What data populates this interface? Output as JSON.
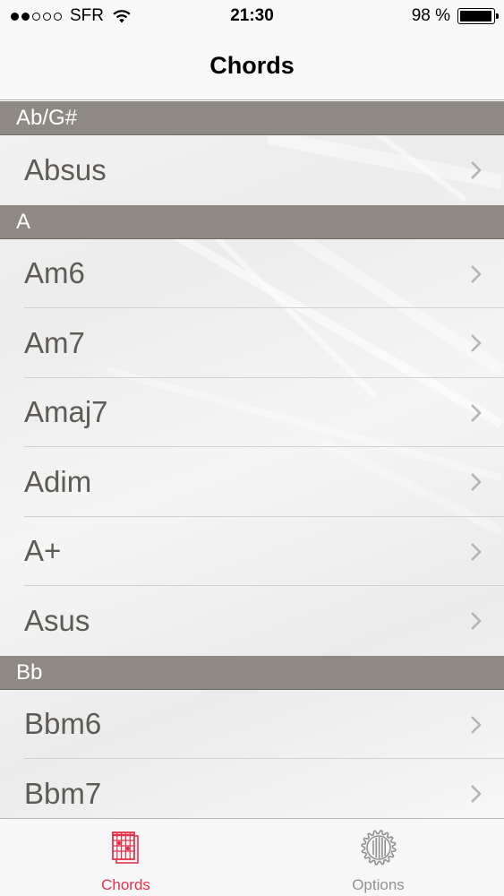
{
  "status_bar": {
    "signal_dots_filled": 2,
    "signal_dots_total": 5,
    "carrier": "SFR",
    "time": "21:30",
    "battery_text": "98 %",
    "battery_level": 0.98
  },
  "nav": {
    "title": "Chords"
  },
  "sections": [
    {
      "header": "Ab/G#",
      "rows": [
        "Absus"
      ]
    },
    {
      "header": "A",
      "rows": [
        "Am6",
        "Am7",
        "Amaj7",
        "Adim",
        "A+",
        "Asus"
      ]
    },
    {
      "header": "Bb",
      "rows": [
        "Bbm6",
        "Bbm7"
      ]
    }
  ],
  "tab_bar": {
    "tabs": [
      {
        "label": "Chords",
        "icon": "chord-grid-icon",
        "selected": true
      },
      {
        "label": "Options",
        "icon": "gear-icon",
        "selected": false
      }
    ],
    "active_color": "#e4314b",
    "inactive_color": "#929292"
  },
  "colors": {
    "section_header_bg": "#8f8983",
    "row_text": "#5e5a55",
    "chevron": "#b4b4b4"
  }
}
